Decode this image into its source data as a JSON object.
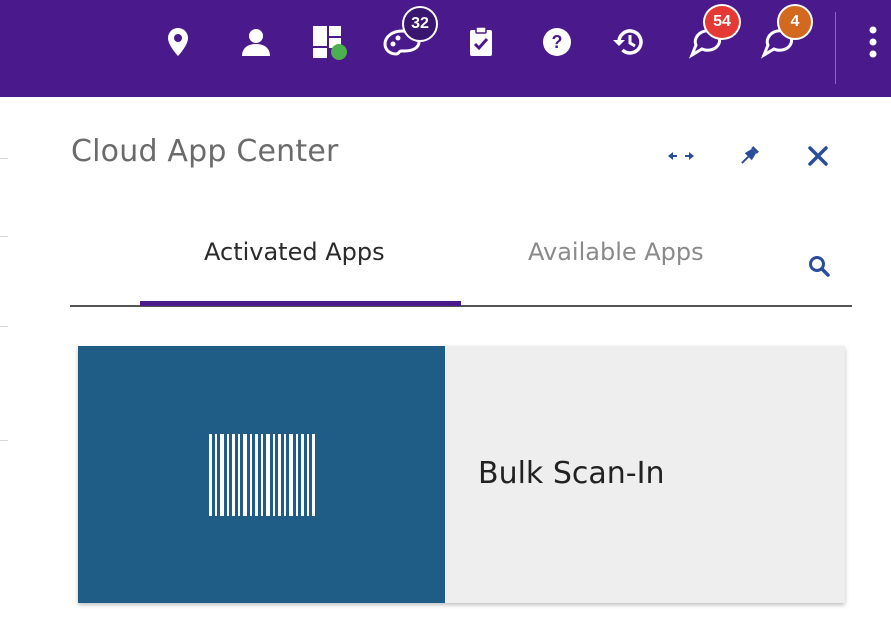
{
  "topbar": {
    "icons": [
      {
        "name": "location-pin-icon"
      },
      {
        "name": "user-icon"
      },
      {
        "name": "dashboard-status-icon"
      },
      {
        "name": "tasks-palette-icon",
        "badge": "32"
      },
      {
        "name": "clipboard-check-icon"
      },
      {
        "name": "help-icon"
      },
      {
        "name": "history-icon"
      },
      {
        "name": "notifications-icon",
        "badge": "54"
      },
      {
        "name": "alerts-icon",
        "badge": "4"
      },
      {
        "name": "more-menu-icon"
      }
    ],
    "colors": {
      "bar": "#4a1a8c",
      "badge_dark": "#3a1670",
      "badge_red": "#e53935",
      "badge_orange": "#d2691e",
      "status_green": "#4caf50"
    }
  },
  "panel": {
    "title": "Cloud App Center",
    "actions": [
      {
        "name": "resize-icon"
      },
      {
        "name": "pin-icon"
      },
      {
        "name": "close-icon"
      }
    ],
    "tabs": [
      {
        "label": "Activated Apps",
        "active": true
      },
      {
        "label": "Available Apps",
        "active": false
      }
    ],
    "search_icon": "search-icon"
  },
  "apps": [
    {
      "label": "Bulk Scan-In",
      "icon": "barcode-icon",
      "tile_color": "#1f5d87"
    }
  ]
}
